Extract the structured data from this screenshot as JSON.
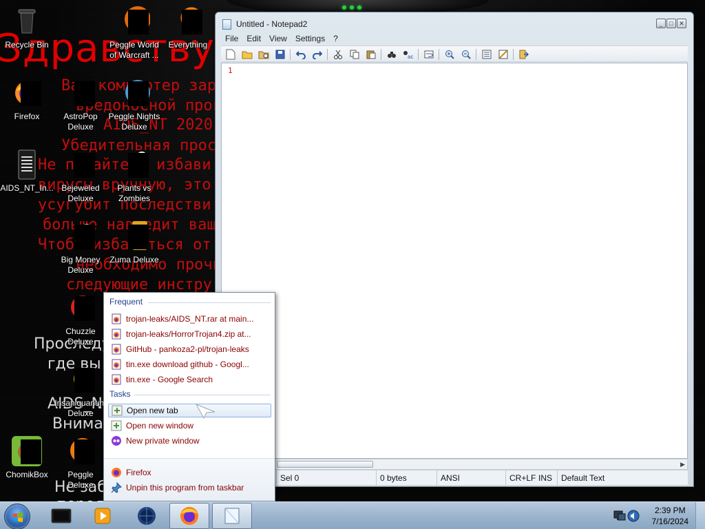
{
  "wallpaper": {
    "title_text": "Здравству",
    "lines": [
      "Ваш компьютер зар",
      "вредоносной програ",
      "AIDS_NT 2020",
      "Убедительная прос",
      "Не пытайтесь избави",
      "вирусы вручную, это",
      "усугубит последстви",
      "больше навредит ваш",
      "Чтобы избавиться от",
      "необходимо прочи",
      "следующие инстру"
    ],
    "white_lines": [
      "Проследу",
      "где вы",
      "AIDS_N",
      "Внимат",
      "Не забы",
      "перед"
    ]
  },
  "desktop_icons": [
    {
      "label": "Recycle Bin",
      "icon": "recycle-bin-icon"
    },
    {
      "label": "Peggle World of Warcraft ...",
      "icon": "peggle-wow-icon"
    },
    {
      "label": "Everything",
      "icon": "everything-search-icon"
    },
    {
      "label": "Firefox",
      "icon": "firefox-icon"
    },
    {
      "label": "AstroPop Deluxe",
      "icon": "astropop-icon"
    },
    {
      "label": "Peggle Nights Deluxe",
      "icon": "peggle-nights-icon"
    },
    {
      "label": "AIDS_NT_In...",
      "icon": "text-document-icon"
    },
    {
      "label": "Bejeweled Deluxe",
      "icon": "bejeweled-icon"
    },
    {
      "label": "Plants vs Zombies",
      "icon": "plants-vs-zombies-icon"
    },
    {
      "label": "Big Money Deluxe",
      "icon": "big-money-icon"
    },
    {
      "label": "Zuma Deluxe",
      "icon": "zuma-icon"
    },
    {
      "label": "Chuzzle Deluxe",
      "icon": "chuzzle-icon"
    },
    {
      "label": "Insaniquarium Deluxe",
      "icon": "insaniquarium-icon"
    },
    {
      "label": "ChomikBox",
      "icon": "chomikbox-icon"
    },
    {
      "label": "Peggle Deluxe",
      "icon": "peggle-deluxe-icon"
    }
  ],
  "notepad": {
    "title": "Untitled - Notepad2",
    "menu": [
      "File",
      "Edit",
      "View",
      "Settings",
      "?"
    ],
    "toolbar_icons": [
      "new-file-icon",
      "open-folder-icon",
      "browse-icon",
      "save-icon",
      "undo-icon",
      "redo-icon",
      "cut-icon",
      "copy-icon",
      "paste-icon",
      "find-icon",
      "replace-icon",
      "word-wrap-icon",
      "zoom-in-icon",
      "zoom-out-icon",
      "schemes-icon",
      "customize-schemes-icon",
      "exit-icon"
    ],
    "line_number": "1",
    "status": {
      "sel": "Sel 0",
      "size": "0 bytes",
      "encoding": "ANSI",
      "eol": "CR+LF",
      "mode": "INS",
      "scheme": "Default Text"
    }
  },
  "jumplist": {
    "frequent_header": "Frequent",
    "frequent": [
      "trojan-leaks/AIDS_NT.rar at main...",
      "trojan-leaks/HorrorTrojan4.zip at...",
      "GitHub - pankoza2-pl/trojan-leaks",
      "tin.exe download github - Googl...",
      "tin.exe - Google Search"
    ],
    "tasks_header": "Tasks",
    "tasks": [
      "Open new tab",
      "Open new window",
      "New private window"
    ],
    "footer": [
      "Firefox",
      "Unpin this program from taskbar"
    ]
  },
  "taskbar": {
    "apps": [
      "terminal-app-icon",
      "media-player-icon",
      "globe-browser-icon",
      "firefox-icon",
      "notepad2-icon"
    ],
    "time": "2:39 PM",
    "date": "7/16/2024"
  },
  "colors": {
    "wallpaper_red": "#c40d0d",
    "jumplist_link": "#8a0000",
    "jumplist_header": "#1e3d8f",
    "taskbar": "#9fb7cf"
  }
}
